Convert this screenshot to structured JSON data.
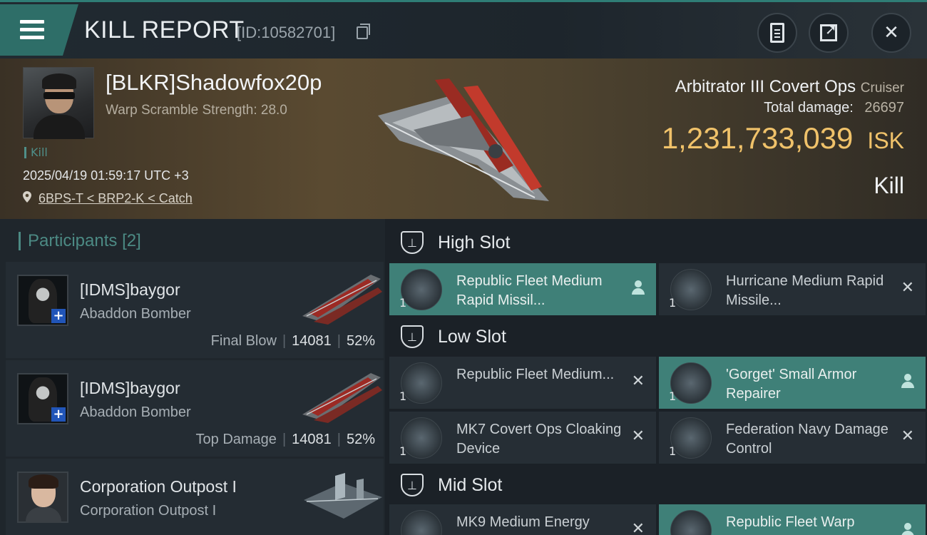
{
  "header": {
    "title": "KILL REPORT",
    "report_id": "[ID:10582701]"
  },
  "victim": {
    "name": "[BLKR]Shadowfox20p",
    "warp_scramble": "Warp Scramble Strength: 28.0",
    "tag": "Kill",
    "datetime": "2025/04/19 01:59:17 UTC +3",
    "location": "6BPS-T < BRP2-K < Catch",
    "ship_name": "Arbitrator III Covert Ops",
    "ship_class": "Cruiser",
    "total_damage_label": "Total damage:",
    "total_damage": "26697",
    "isk_value": "1,231,733,039",
    "isk_unit": "ISK",
    "result": "Kill"
  },
  "participants": {
    "label": "Participants",
    "count": "[2]",
    "rows": [
      {
        "name": "[IDMS]baygor",
        "ship": "Abaddon Bomber",
        "role": "Final Blow",
        "damage": "14081",
        "percent": "52%"
      },
      {
        "name": "[IDMS]baygor",
        "ship": "Abaddon Bomber",
        "role": "Top Damage",
        "damage": "14081",
        "percent": "52%"
      },
      {
        "name": "Corporation Outpost I",
        "ship": "Corporation Outpost I"
      }
    ]
  },
  "slots": {
    "high": {
      "label": "High Slot",
      "modules": [
        {
          "name": "Republic Fleet Medium Rapid Missil...",
          "qty": "1",
          "status": "person-icon",
          "highlight": true
        },
        {
          "name": "Hurricane Medium Rapid Missile...",
          "qty": "1",
          "status": "close-icon",
          "highlight": false
        }
      ]
    },
    "low": {
      "label": "Low Slot",
      "modules": [
        {
          "name": "Republic Fleet Medium...",
          "qty": "1",
          "status": "close-icon",
          "highlight": false
        },
        {
          "name": "'Gorget' Small Armor Repairer",
          "qty": "1",
          "status": "person-icon",
          "highlight": true
        },
        {
          "name": "MK7 Covert Ops Cloaking Device",
          "qty": "1",
          "status": "close-icon",
          "highlight": false
        },
        {
          "name": "Federation Navy Damage Control",
          "qty": "1",
          "status": "close-icon",
          "highlight": false
        }
      ]
    },
    "mid": {
      "label": "Mid Slot",
      "modules": [
        {
          "name": "MK9 Medium Energy",
          "status": "close-icon",
          "highlight": false
        },
        {
          "name": "Republic Fleet Warp",
          "status": "person-icon",
          "highlight": true
        }
      ]
    }
  },
  "colors": {
    "accent_teal": "#3f8078",
    "isk_gold": "#f0c26a"
  }
}
